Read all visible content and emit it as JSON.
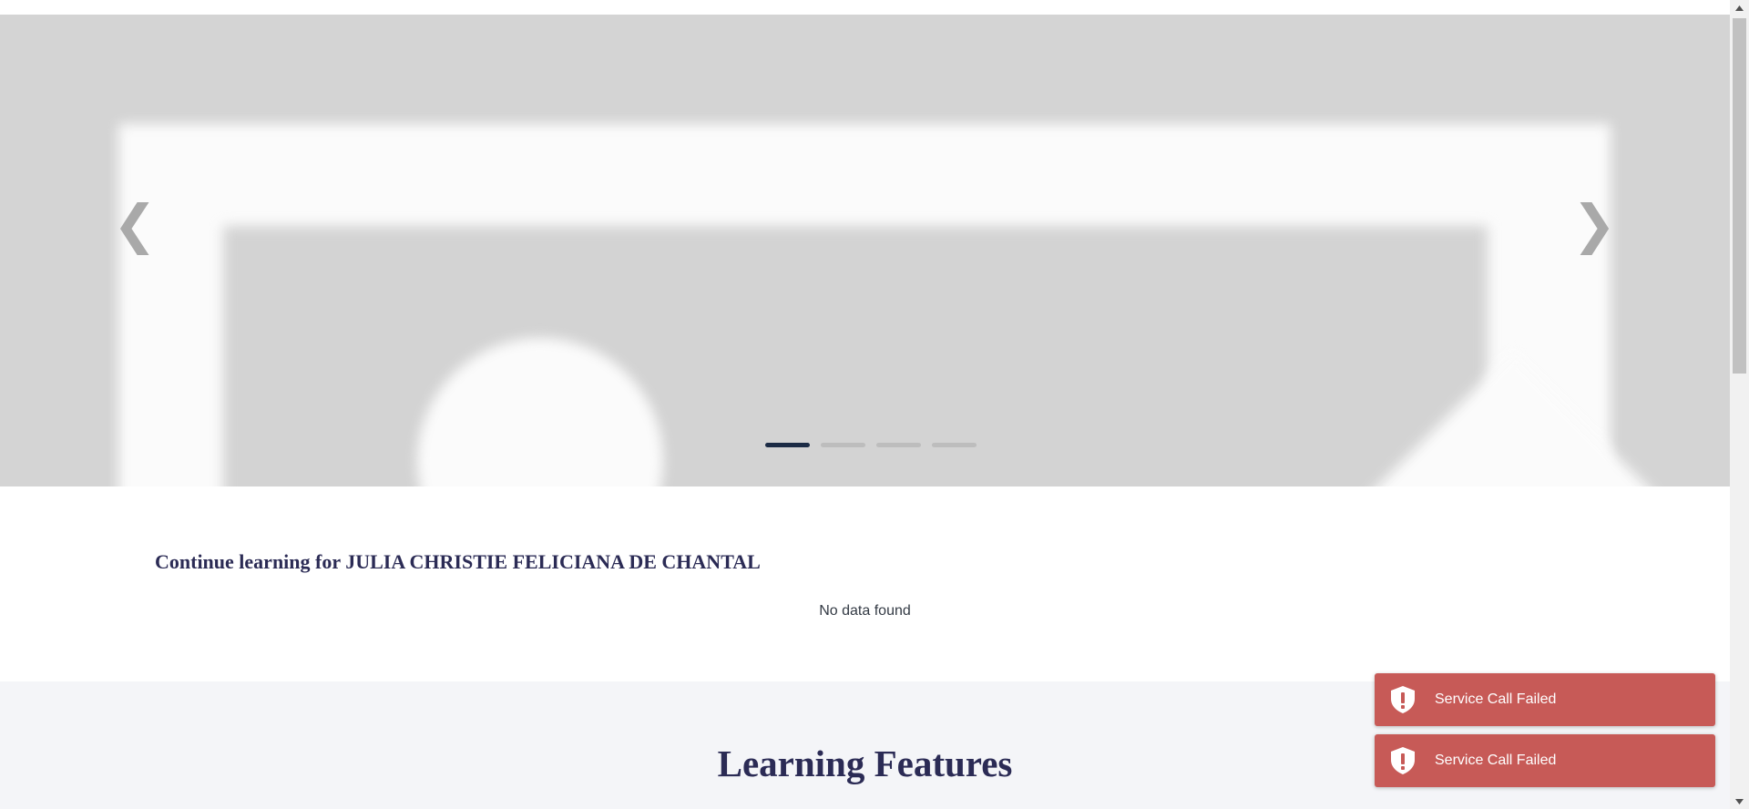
{
  "carousel": {
    "prev_glyph": "❮",
    "next_glyph": "❯",
    "indicator_count": 4,
    "active_indicator": 1,
    "colors": {
      "indicator_active": "#1b2b45",
      "indicator_inactive": "#bdbdbd",
      "placeholder": "#d4d4d4"
    }
  },
  "continue_learning": {
    "title": "Continue learning for JULIA CHRISTIE FELICIANA DE CHANTAL",
    "empty_message": "No data found"
  },
  "features": {
    "title": "Learning Features"
  },
  "toasts": [
    {
      "message": "Service Call Failed",
      "icon": "shield-exclamation-icon",
      "color": "#c75a57"
    },
    {
      "message": "Service Call Failed",
      "icon": "shield-exclamation-icon",
      "color": "#c75a57"
    }
  ],
  "colors": {
    "heading": "#2b2b55",
    "section_bg": "#f4f5f8",
    "error": "#c75a57"
  }
}
